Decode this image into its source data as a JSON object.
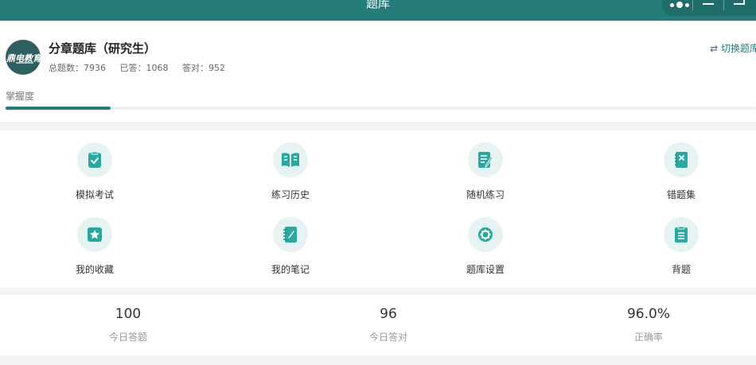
{
  "topbar": {
    "title": "题库"
  },
  "header": {
    "logo_text": "鼎电教育",
    "title": "分章题库（研究生）",
    "total": "总题数：7936",
    "answered": "已答：1068",
    "correct": "答对：952",
    "switch_label": "⇄ 切换题库",
    "mastery_label": "掌握度",
    "mastery_progress": 0.14
  },
  "grid": {
    "items": [
      {
        "label": "模拟考试",
        "icon": "exam-icon"
      },
      {
        "label": "练习历史",
        "icon": "book-icon"
      },
      {
        "label": "随机练习",
        "icon": "random-practice-icon"
      },
      {
        "label": "错题集",
        "icon": "wrong-notebook-icon"
      },
      {
        "label": "我的收藏",
        "icon": "star-icon"
      },
      {
        "label": "我的笔记",
        "icon": "note-icon"
      },
      {
        "label": "题库设置",
        "icon": "gear-icon"
      },
      {
        "label": "背题",
        "icon": "recite-icon"
      }
    ]
  },
  "stats": {
    "items": [
      {
        "value": "100",
        "label": "今日答题"
      },
      {
        "value": "96",
        "label": "今日答对"
      },
      {
        "value": "96.0%",
        "label": "正确率"
      }
    ]
  },
  "colors": {
    "accent": "#257c79",
    "icon_bg": "#e6f3f2",
    "icon_fg": "#2aa8a0"
  }
}
